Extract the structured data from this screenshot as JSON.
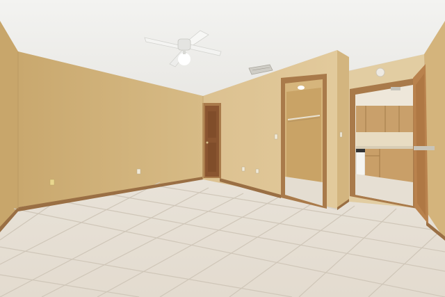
{
  "icons": {
    "ceiling_fan": "ceiling-fan-icon",
    "light": "ceiling-light-icon",
    "vent": "air-vent-icon",
    "outlet": "electrical-outlet-icon",
    "switch": "light-switch-icon"
  },
  "colors": {
    "wall": "#d9be8a",
    "wall_shadow": "#c9aa72",
    "ceiling": "#f1f1ef",
    "floor_tile": "#e7e0d6",
    "grout": "#cfc6b8",
    "door_trim": "#a97a4a",
    "baseboard": "#9a6f44",
    "cabinet": "#c9a06b"
  }
}
